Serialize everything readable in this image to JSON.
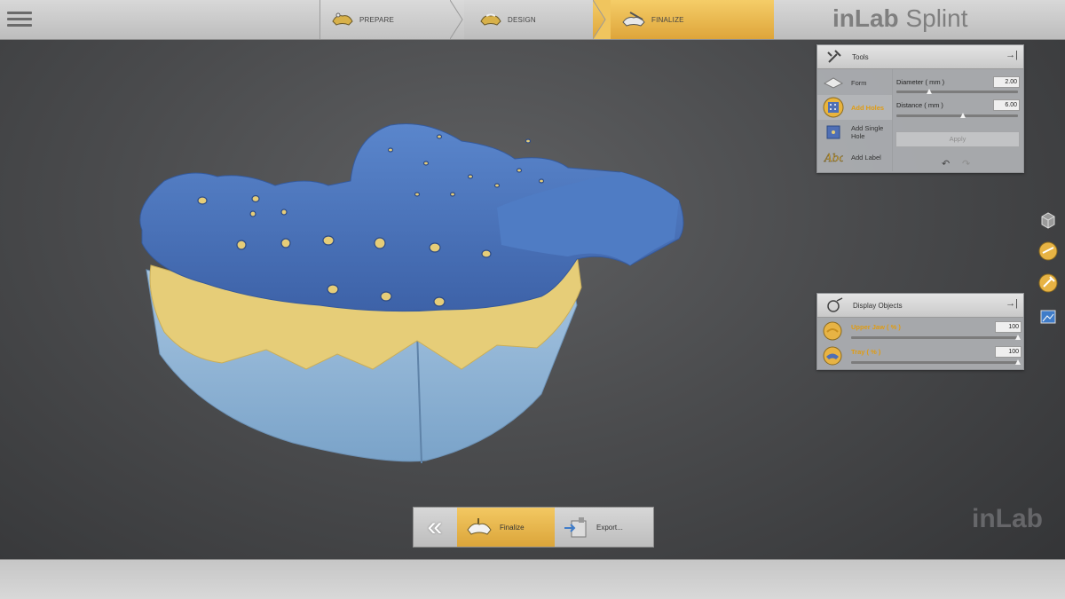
{
  "app": {
    "brand_bold": "inLab",
    "brand_light": " Splint",
    "watermark": "inLab"
  },
  "steps": [
    {
      "label": "PREPARE",
      "active": false
    },
    {
      "label": "DESIGN",
      "active": false
    },
    {
      "label": "FINALIZE",
      "active": true
    }
  ],
  "tools_panel": {
    "title": "Tools",
    "items": [
      {
        "label": "Form",
        "icon": "form-icon"
      },
      {
        "label": "Add Holes",
        "icon": "add-holes-icon",
        "active": true
      },
      {
        "label": "Add Single Hole",
        "icon": "add-single-hole-icon"
      },
      {
        "label": "Add Label",
        "icon": "add-label-icon"
      }
    ],
    "diameter_label": "Diameter ( mm )",
    "diameter_value": "2.00",
    "diameter_level": 0.27,
    "distance_label": "Distance ( mm )",
    "distance_value": "6.00",
    "distance_level": 0.55,
    "apply_label": "Apply",
    "undo_glyph": "↶",
    "redo_glyph": "↷",
    "pin_glyph": "→|"
  },
  "display_panel": {
    "title": "Display Objects",
    "pin_glyph": "→|",
    "items": [
      {
        "label": "Upper Jaw ( % )",
        "value": "100",
        "level": 1.0
      },
      {
        "label": "Tray ( % )",
        "value": "100",
        "level": 1.0
      }
    ]
  },
  "bottom": {
    "back_glyph": "«",
    "finalize_label": "Finalize",
    "export_label": "Export..."
  },
  "colors": {
    "accent": "#e09c12",
    "splint_blue": "#4a73b8",
    "model_yellow": "#e8cf7c",
    "model_base": "#8fb4d6"
  }
}
